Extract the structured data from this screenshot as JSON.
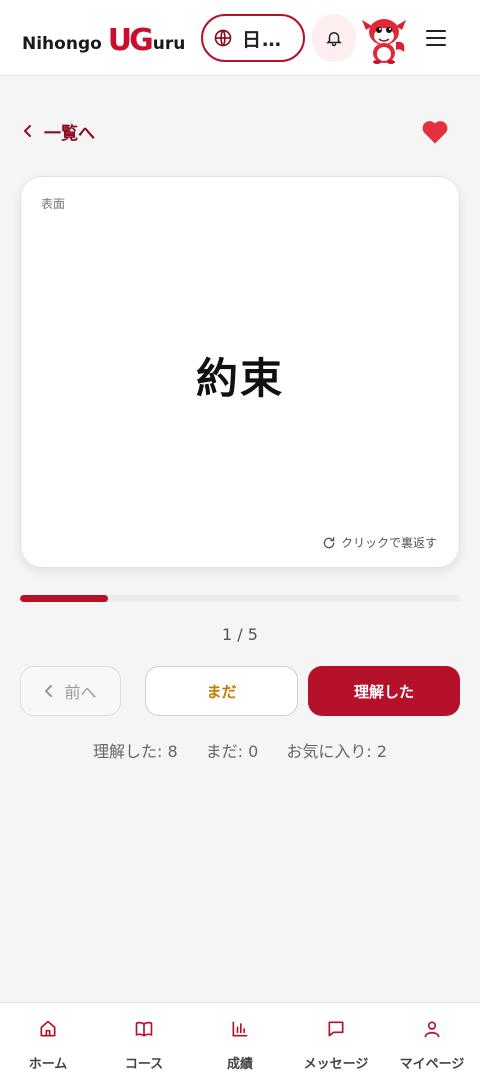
{
  "header": {
    "logo_part1": "Nihongo",
    "logo_part2": "UG",
    "logo_part3": "uru",
    "language_label": "日…",
    "brand_color": "#b5112b"
  },
  "nav_top": {
    "back_label": "一覧へ",
    "favorite_active": true
  },
  "card": {
    "side_label": "表面",
    "word": "約束",
    "flip_hint": "クリックで裏返す"
  },
  "progress": {
    "current": 1,
    "total": 5,
    "counter_text": "1 / 5",
    "fraction": 0.2
  },
  "buttons": {
    "prev_label": "前へ",
    "not_yet_label": "まだ",
    "understood_label": "理解した"
  },
  "stats": {
    "understood": "理解した: 8",
    "not_yet": "まだ: 0",
    "favorites": "お気に入り: 2"
  },
  "bottom_nav": {
    "items": [
      {
        "label": "ホーム",
        "icon": "home-icon"
      },
      {
        "label": "コース",
        "icon": "book-icon"
      },
      {
        "label": "成績",
        "icon": "bar-chart-icon"
      },
      {
        "label": "メッセージ",
        "icon": "message-icon"
      },
      {
        "label": "マイページ",
        "icon": "user-icon"
      }
    ]
  }
}
